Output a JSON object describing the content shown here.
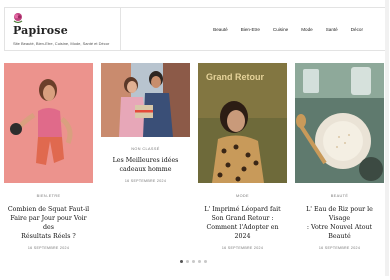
{
  "site": {
    "name": "Papirose",
    "tagline": "Site Beauté, Bien-Etre, Cuisine, Mode, Santé et Décor",
    "logo_icon": "rose-icon",
    "accent": "#c0427f"
  },
  "nav": {
    "items": [
      {
        "label": "Beauté"
      },
      {
        "label": "Bien-Etre"
      },
      {
        "label": "Cuisine"
      },
      {
        "label": "Mode"
      },
      {
        "label": "Santé"
      },
      {
        "label": "Décor"
      }
    ]
  },
  "cards": [
    {
      "category": "BIEN-ETRE",
      "title_l1": "Combien de Squat Faut-il",
      "title_l2": "Faire par Jour pour Voir des",
      "title_l3": "Résultats Réels ?",
      "date": "16 SEPTEMBRE 2024",
      "image": "woman-workout-kettlebell"
    },
    {
      "category": "NON CLASSÉ",
      "title_l1": "Les Meilleures idées",
      "title_l2": "cadeaux homme",
      "date": "16 SEPTEMBRE 2024",
      "image": "couple-gift-box"
    },
    {
      "category": "MODE",
      "title_l1": "L' Imprimé Léopard fait",
      "title_l2": "Son Grand Retour :",
      "title_l3": "Comment l'Adopter en 2024",
      "date": "16 SEPTEMBRE 2024",
      "image": "leopard-print-woman",
      "overlay": "Grand Retour"
    },
    {
      "category": "BEAUTÉ",
      "title_l1": "L' Eau de Riz pour le Visage",
      "title_l2": ": Votre Nouvel Atout",
      "title_l3": "Beauté",
      "date": "16 SEPTEMBRE 2024",
      "image": "rice-water-bowls"
    }
  ],
  "pager": {
    "count": 5,
    "active_index": 0
  }
}
